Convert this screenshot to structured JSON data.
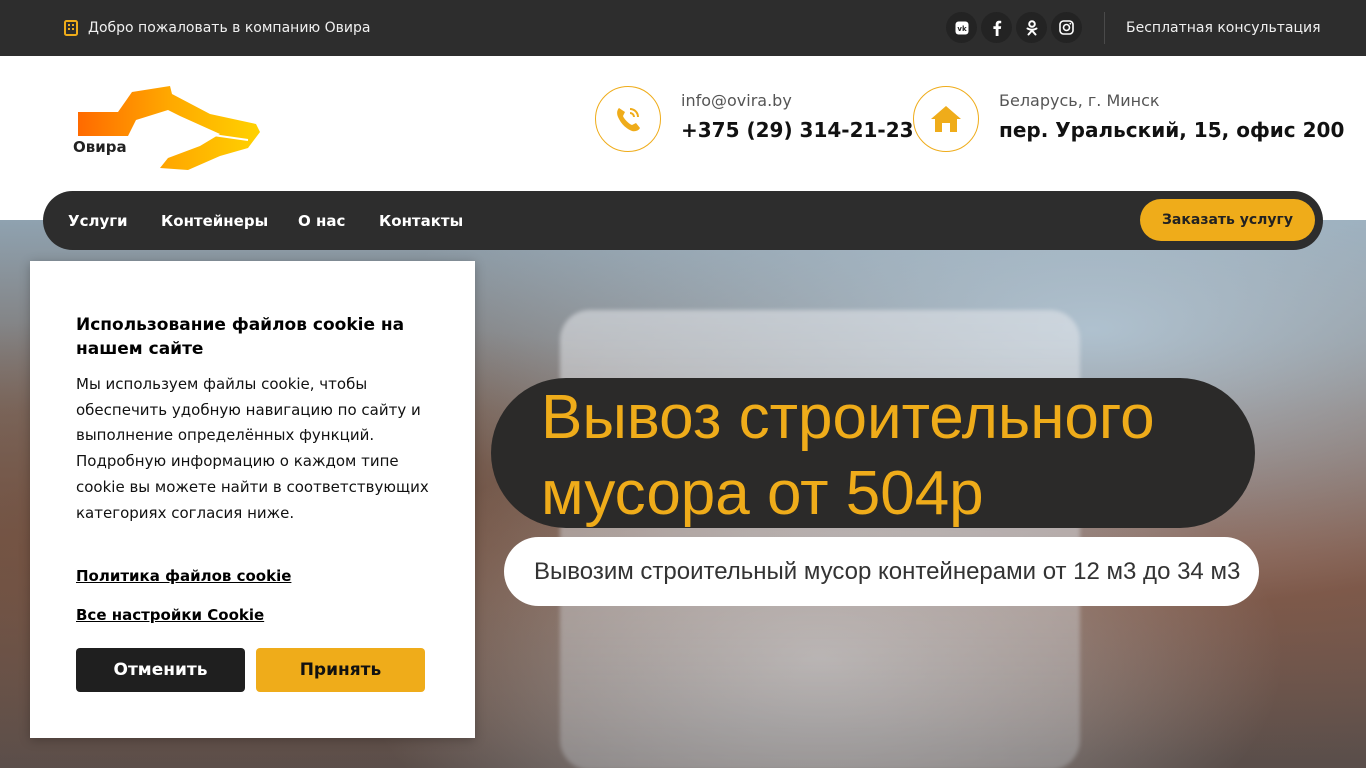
{
  "topbar": {
    "welcome": "Добро пожаловать в компанию Овира",
    "socials": [
      {
        "name": "vk-icon",
        "glyph": "vk"
      },
      {
        "name": "facebook-icon",
        "glyph": "f"
      },
      {
        "name": "odnoklassniki-icon",
        "glyph": "ok"
      },
      {
        "name": "instagram-icon",
        "glyph": "ig"
      }
    ],
    "consult": "Бесплатная консультация"
  },
  "header": {
    "logo_text": "Овира",
    "email": "info@ovira.by",
    "phone": "+375 (29) 314-21-23",
    "location": "Беларусь, г. Минск",
    "address": "пер. Уральский, 15, офис 200"
  },
  "nav": {
    "items": [
      "Услуги",
      "Контейнеры",
      "О нас",
      "Контакты"
    ],
    "order_button": "Заказать услугу"
  },
  "hero": {
    "title": "Вывоз строительного мусора от 504р",
    "subtitle": "Вывозим строительный мусор контейнерами от 12 м3 до 34 м3"
  },
  "cookie": {
    "title": "Использование файлов cookie на нашем сайте",
    "text": "Мы используем файлы cookie, чтобы обеспечить удобную навигацию по сайту и выполнение определённых функций. Подробную информацию о каждом типе cookie вы можете найти в соответствующих категориях согласия ниже.",
    "policy_link": "Политика файлов cookie",
    "settings_link": "Все настройки Cookie",
    "cancel_button": "Отменить",
    "accept_button": "Принять"
  },
  "colors": {
    "accent": "#efac1a",
    "dark": "#2d2d2d"
  }
}
